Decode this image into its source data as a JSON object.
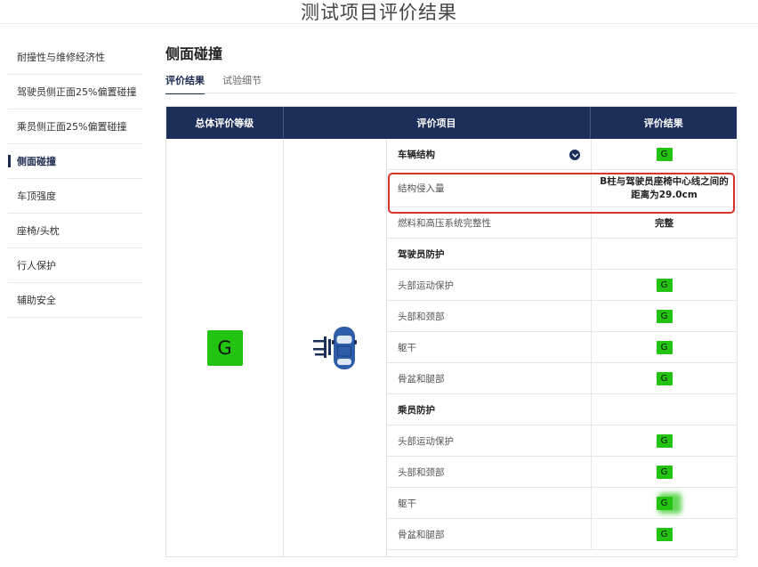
{
  "page": {
    "title": "测试项目评价结果"
  },
  "sidebar": {
    "items": [
      {
        "label": "耐撞性与维修经济性",
        "active": false
      },
      {
        "label": "驾驶员侧正面25%偏置碰撞",
        "active": false
      },
      {
        "label": "乘员侧正面25%偏置碰撞",
        "active": false
      },
      {
        "label": "侧面碰撞",
        "active": true
      },
      {
        "label": "车顶强度",
        "active": false
      },
      {
        "label": "座椅/头枕",
        "active": false
      },
      {
        "label": "行人保护",
        "active": false
      },
      {
        "label": "辅助安全",
        "active": false
      }
    ]
  },
  "section": {
    "title": "侧面碰撞",
    "tabs": [
      {
        "label": "评价结果",
        "active": true
      },
      {
        "label": "试验细节",
        "active": false
      }
    ]
  },
  "table": {
    "headers": {
      "overall": "总体评价等级",
      "items": "评价项目",
      "result": "评价结果"
    },
    "overall_grade": "G",
    "grade_color": "#22c411",
    "header_color": "#1c2e5a",
    "highlight_color": "#d9342b",
    "rows": [
      {
        "item": "车辆结构",
        "result": "G"
      },
      {
        "item": "结构侵入量",
        "result_line1": "B柱与驾驶员座椅中心线之间的",
        "result_line2": "距离为29.0cm"
      },
      {
        "item": "燃料和高压系统完整性",
        "result": "完整"
      },
      {
        "item": "驾驶员防护",
        "result": ""
      },
      {
        "item": "头部运动保护",
        "result": "G"
      },
      {
        "item": "头部和颈部",
        "result": "G"
      },
      {
        "item": "躯干",
        "result": "G"
      },
      {
        "item": "骨盆和腿部",
        "result": "G"
      },
      {
        "item": "乘员防护",
        "result": ""
      },
      {
        "item": "头部运动保护",
        "result": "G"
      },
      {
        "item": "头部和颈部",
        "result": "G"
      },
      {
        "item": "躯干",
        "result": "G"
      },
      {
        "item": "骨盆和腿部",
        "result": "G"
      }
    ]
  }
}
